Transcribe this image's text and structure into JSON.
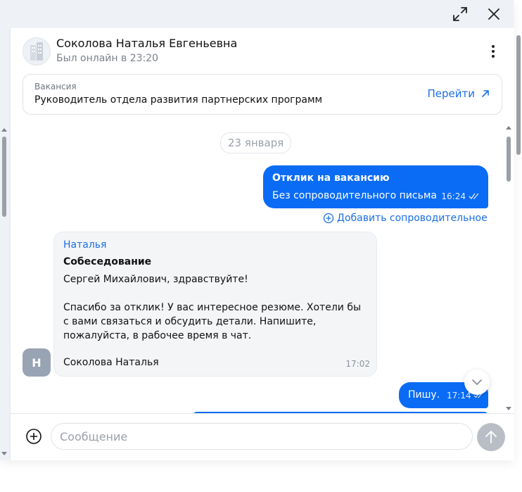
{
  "window": {
    "expand_icon": "expand-icon",
    "close_icon": "close-icon"
  },
  "header": {
    "name": "Соколова Наталья Евгеньевна",
    "status": "Был онлайн в 23:20"
  },
  "vacancy": {
    "label": "Вакансия",
    "title": "Руководитель отдела развития партнерских программ",
    "go_label": "Перейти"
  },
  "chat": {
    "date": "23 января",
    "messages": [
      {
        "direction": "outgoing",
        "title": "Отклик на вакансию",
        "text": "Без сопроводительного письма",
        "time": "16:24"
      },
      {
        "direction": "incoming",
        "sender": "Наталья",
        "title": "Собеседование",
        "text": "Сергей Михайлович, здравствуйте!\n\nСпасибо за отклик! У вас интересное резюме. Хотели бы с вами связаться и обсудить детали. Напишите, пожалуйста, в рабочее время в чат.",
        "signature": "Соколова Наталья",
        "time": "17:02",
        "avatar_letter": "Н"
      },
      {
        "direction": "outgoing",
        "text": "Пишу.",
        "time": "17:14"
      }
    ],
    "add_cover_label": "Добавить сопроводительное"
  },
  "composer": {
    "placeholder": "Сообщение",
    "value": ""
  },
  "colors": {
    "accent": "#0a6cf5",
    "link": "#1a6fe6",
    "incoming_bg": "#f4f5f7",
    "avatar_bg": "#98a3b3"
  }
}
